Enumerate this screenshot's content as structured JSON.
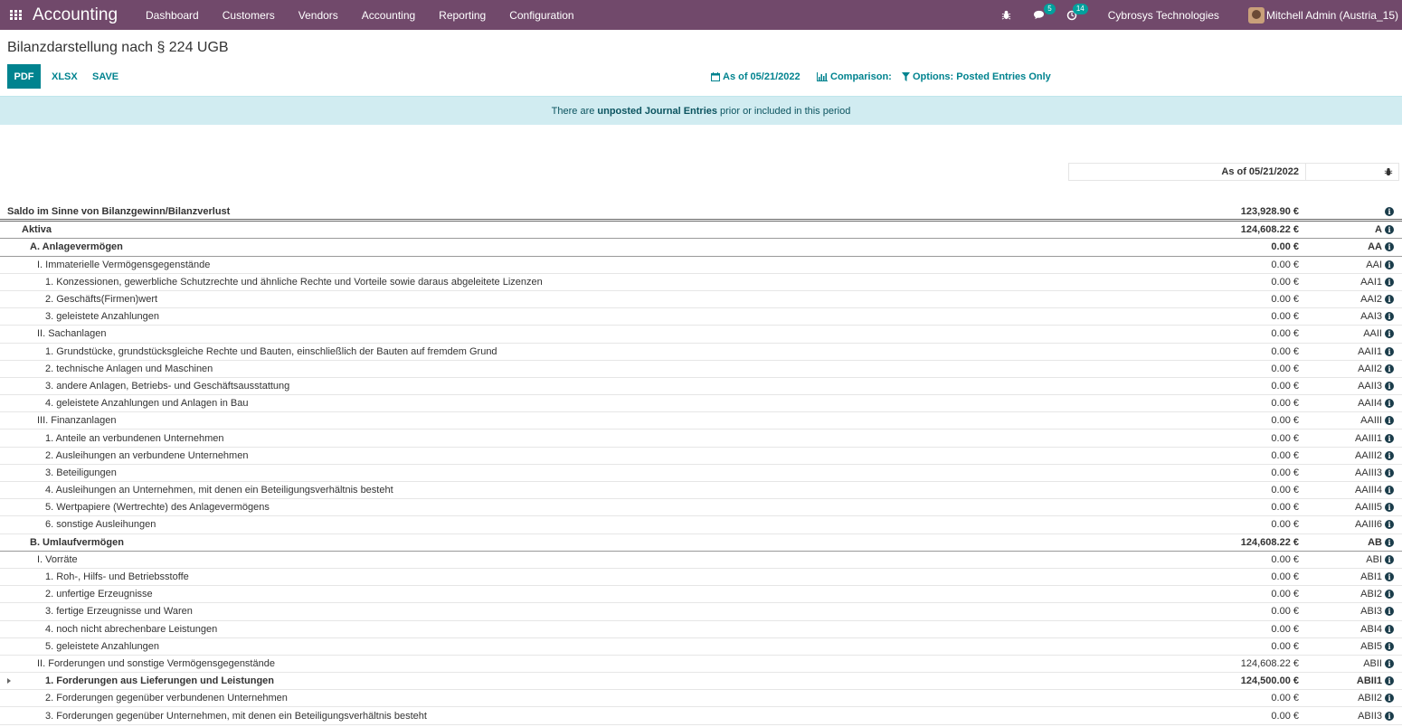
{
  "nav": {
    "brand": "Accounting",
    "menu": [
      "Dashboard",
      "Customers",
      "Vendors",
      "Accounting",
      "Reporting",
      "Configuration"
    ],
    "chat_badge": "5",
    "activity_badge": "14",
    "company": "Cybrosys Technologies",
    "user": "Mitchell Admin (Austria_15)"
  },
  "page": {
    "title": "Bilanzdarstellung nach § 224 UGB",
    "buttons": {
      "pdf": "PDF",
      "xlsx": "XLSX",
      "save": "SAVE"
    },
    "filters": {
      "date": "As of 05/21/2022",
      "comparison": "Comparison:",
      "options": "Options: Posted Entries Only"
    },
    "alert": {
      "prefix": "There are",
      "strong": "unposted Journal Entries",
      "suffix": "prior or included in this period"
    },
    "column_header": "As of 05/21/2022"
  },
  "rows": [
    {
      "label": "Saldo im Sinne von Bilanzgewinn/Bilanzverlust",
      "value": "123,928.90 €",
      "code": "",
      "level": 0,
      "bold": true,
      "style": "top"
    },
    {
      "label": "Aktiva",
      "value": "124,608.22 €",
      "code": "A",
      "level": 1,
      "bold": true,
      "style": "sec"
    },
    {
      "label": "A. Anlagevermögen",
      "value": "0.00 €",
      "code": "AA",
      "level": 2,
      "bold": true,
      "style": "sec"
    },
    {
      "label": "I. Immaterielle Vermögensgegenstände",
      "value": "0.00 €",
      "code": "AAI",
      "level": 3,
      "bold": false,
      "style": ""
    },
    {
      "label": "1. Konzessionen, gewerbliche Schutzrechte und ähnliche Rechte und Vorteile sowie daraus abgeleitete Lizenzen",
      "value": "0.00 €",
      "code": "AAI1",
      "level": 4,
      "bold": false,
      "style": ""
    },
    {
      "label": "2. Geschäfts(Firmen)wert",
      "value": "0.00 €",
      "code": "AAI2",
      "level": 4,
      "bold": false,
      "style": ""
    },
    {
      "label": "3. geleistete Anzahlungen",
      "value": "0.00 €",
      "code": "AAI3",
      "level": 4,
      "bold": false,
      "style": ""
    },
    {
      "label": "II. Sachanlagen",
      "value": "0.00 €",
      "code": "AAII",
      "level": 3,
      "bold": false,
      "style": ""
    },
    {
      "label": "1. Grundstücke, grundstücksgleiche Rechte und Bauten, einschließlich der Bauten auf fremdem Grund",
      "value": "0.00 €",
      "code": "AAII1",
      "level": 4,
      "bold": false,
      "style": ""
    },
    {
      "label": "2. technische Anlagen und Maschinen",
      "value": "0.00 €",
      "code": "AAII2",
      "level": 4,
      "bold": false,
      "style": ""
    },
    {
      "label": "3. andere Anlagen, Betriebs- und Geschäftsausstattung",
      "value": "0.00 €",
      "code": "AAII3",
      "level": 4,
      "bold": false,
      "style": ""
    },
    {
      "label": "4. geleistete Anzahlungen und Anlagen in Bau",
      "value": "0.00 €",
      "code": "AAII4",
      "level": 4,
      "bold": false,
      "style": ""
    },
    {
      "label": "III. Finanzanlagen",
      "value": "0.00 €",
      "code": "AAIII",
      "level": 3,
      "bold": false,
      "style": ""
    },
    {
      "label": "1. Anteile an verbundenen Unternehmen",
      "value": "0.00 €",
      "code": "AAIII1",
      "level": 4,
      "bold": false,
      "style": ""
    },
    {
      "label": "2. Ausleihungen an verbundene Unternehmen",
      "value": "0.00 €",
      "code": "AAIII2",
      "level": 4,
      "bold": false,
      "style": ""
    },
    {
      "label": "3. Beteiligungen",
      "value": "0.00 €",
      "code": "AAIII3",
      "level": 4,
      "bold": false,
      "style": ""
    },
    {
      "label": "4. Ausleihungen an Unternehmen, mit denen ein Beteiligungsverhältnis besteht",
      "value": "0.00 €",
      "code": "AAIII4",
      "level": 4,
      "bold": false,
      "style": ""
    },
    {
      "label": "5. Wertpapiere (Wertrechte) des Anlagevermögens",
      "value": "0.00 €",
      "code": "AAIII5",
      "level": 4,
      "bold": false,
      "style": ""
    },
    {
      "label": "6. sonstige Ausleihungen",
      "value": "0.00 €",
      "code": "AAIII6",
      "level": 4,
      "bold": false,
      "style": ""
    },
    {
      "label": "B. Umlaufvermögen",
      "value": "124,608.22 €",
      "code": "AB",
      "level": 2,
      "bold": true,
      "style": "sec"
    },
    {
      "label": "I. Vorräte",
      "value": "0.00 €",
      "code": "ABI",
      "level": 3,
      "bold": false,
      "style": ""
    },
    {
      "label": "1. Roh-, Hilfs- und Betriebsstoffe",
      "value": "0.00 €",
      "code": "ABI1",
      "level": 4,
      "bold": false,
      "style": ""
    },
    {
      "label": "2. unfertige Erzeugnisse",
      "value": "0.00 €",
      "code": "ABI2",
      "level": 4,
      "bold": false,
      "style": ""
    },
    {
      "label": "3. fertige Erzeugnisse und Waren",
      "value": "0.00 €",
      "code": "ABI3",
      "level": 4,
      "bold": false,
      "style": ""
    },
    {
      "label": "4. noch nicht abrechenbare Leistungen",
      "value": "0.00 €",
      "code": "ABI4",
      "level": 4,
      "bold": false,
      "style": ""
    },
    {
      "label": "5. geleistete Anzahlungen",
      "value": "0.00 €",
      "code": "ABI5",
      "level": 4,
      "bold": false,
      "style": ""
    },
    {
      "label": "II. Forderungen und sonstige Vermögensgegenstände",
      "value": "124,608.22 €",
      "code": "ABII",
      "level": 3,
      "bold": false,
      "style": ""
    },
    {
      "label": "1. Forderungen aus Lieferungen und Leistungen",
      "value": "124,500.00 €",
      "code": "ABII1",
      "level": 4,
      "bold": true,
      "style": "",
      "expandable": true
    },
    {
      "label": "2. Forderungen gegenüber verbundenen Unternehmen",
      "value": "0.00 €",
      "code": "ABII2",
      "level": 4,
      "bold": false,
      "style": ""
    },
    {
      "label": "3. Forderungen gegenüber Unternehmen, mit denen ein Beteiligungsverhältnis besteht",
      "value": "0.00 €",
      "code": "ABII3",
      "level": 4,
      "bold": false,
      "style": ""
    }
  ]
}
